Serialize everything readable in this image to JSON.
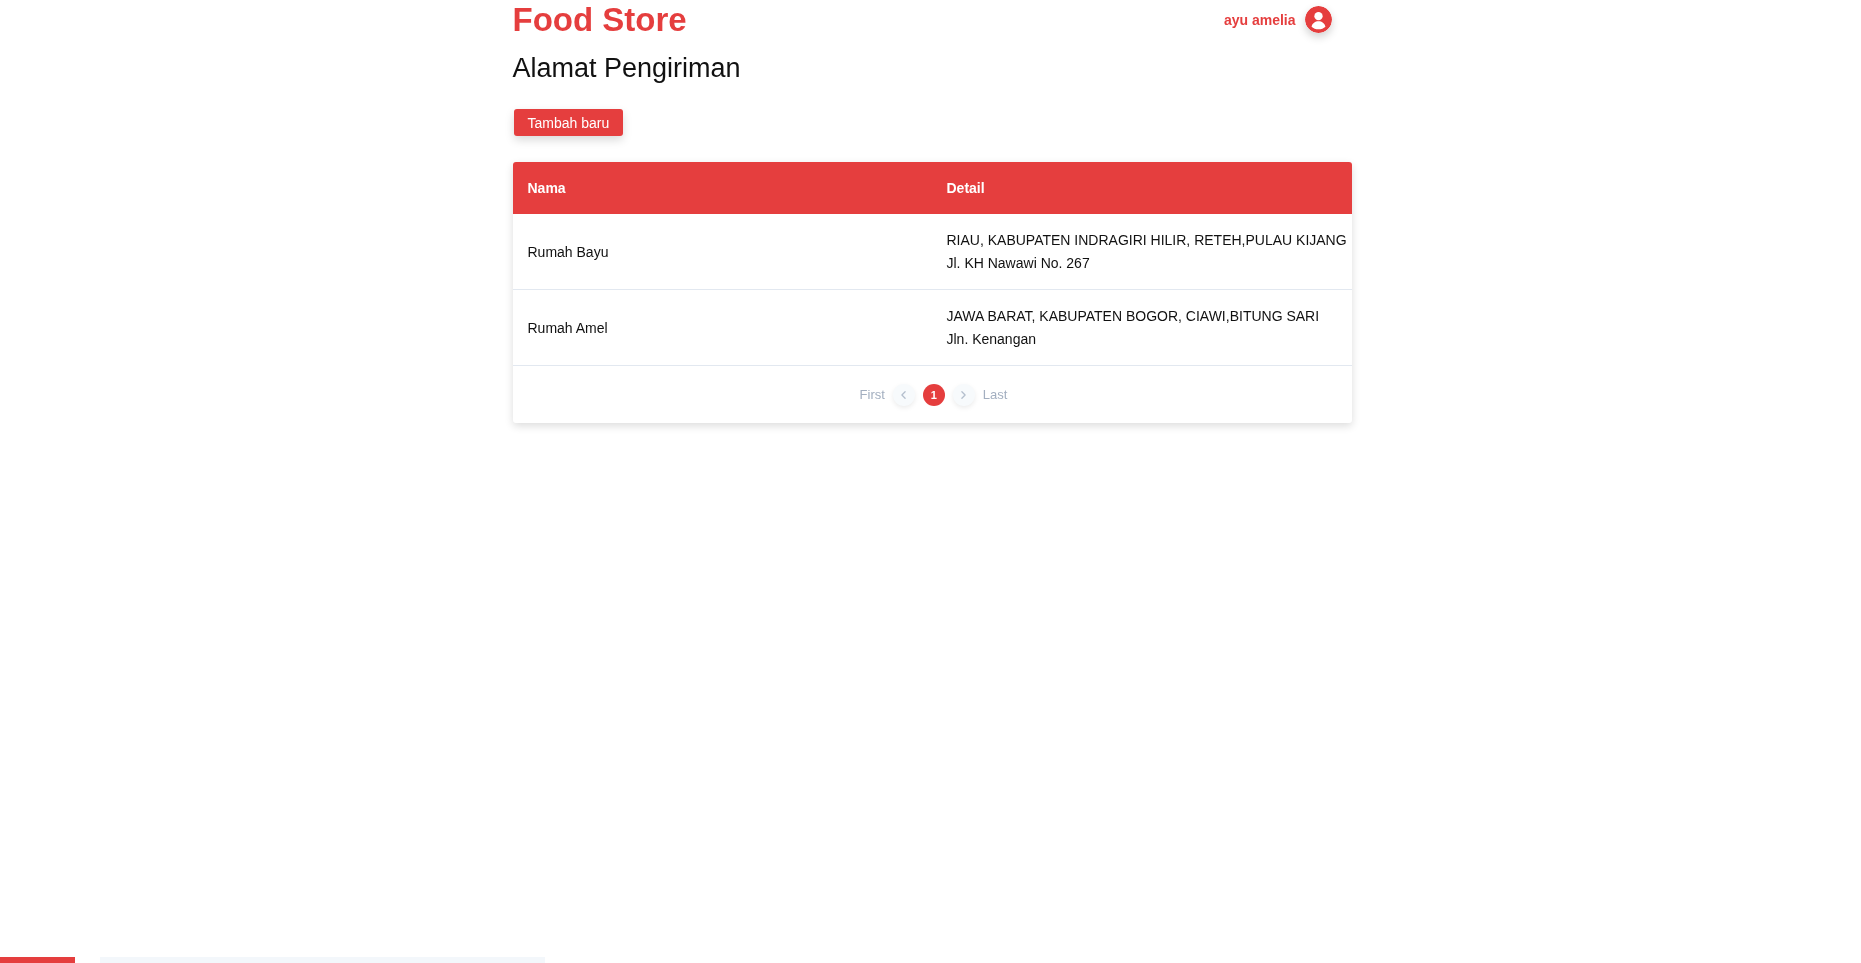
{
  "header": {
    "brand": "Food Store",
    "user": {
      "name": "ayu amelia"
    }
  },
  "page_title": "Alamat Pengiriman",
  "add_button": {
    "label": "Tambah baru"
  },
  "table": {
    "columns": [
      "Nama",
      "Detail"
    ],
    "rows": [
      {
        "name": "Rumah Bayu",
        "detail": [
          "RIAU, KABUPATEN INDRAGIRI HILIR, RETEH,PULAU KIJANG",
          "Jl. KH Nawawi No. 267"
        ]
      },
      {
        "name": "Rumah Amel",
        "detail": [
          "JAWA BARAT, KABUPATEN BOGOR, CIAWI,BITUNG SARI",
          "Jln. Kenangan"
        ]
      }
    ]
  },
  "pagination": [
    {
      "kind": "label",
      "label": "First",
      "disabled": true
    },
    {
      "kind": "prev",
      "disabled": true
    },
    {
      "kind": "page",
      "label": "1",
      "selected": true
    },
    {
      "kind": "next",
      "disabled": true
    },
    {
      "kind": "label",
      "label": "Last",
      "disabled": true
    }
  ]
}
